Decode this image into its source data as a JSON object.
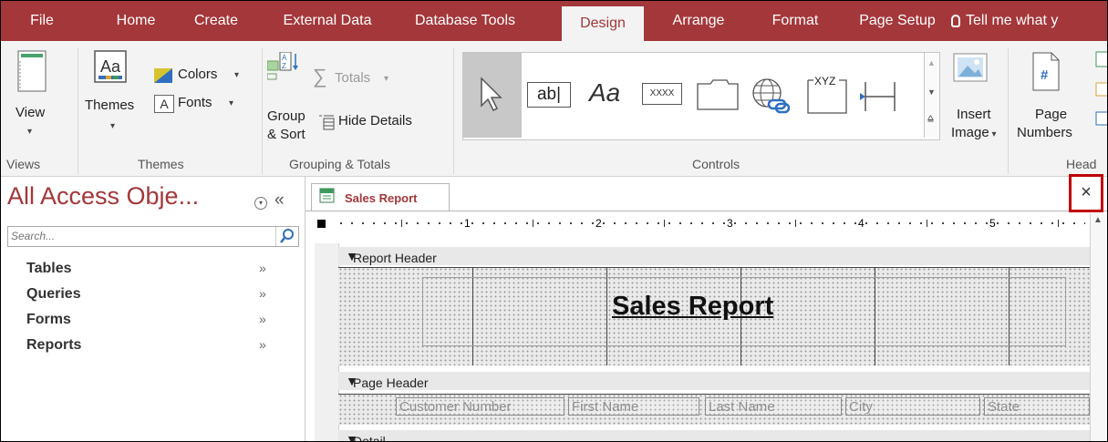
{
  "ribbon_tabs": [
    "File",
    "Home",
    "Create",
    "External Data",
    "Database Tools",
    "Design",
    "Arrange",
    "Format",
    "Page Setup"
  ],
  "active_tab": "Design",
  "tell_me": "Tell me what y",
  "groups": {
    "views": {
      "label": "Views",
      "view_button": "View"
    },
    "themes": {
      "label": "Themes",
      "themes_button": "Themes",
      "colors_button": "Colors",
      "fonts_button": "Fonts",
      "fonts_icon_text": "A",
      "themes_icon_text": "Aa"
    },
    "grouping": {
      "label": "Grouping & Totals",
      "group_sort_line1": "Group",
      "group_sort_line2": "& Sort",
      "totals": "Totals",
      "hide_details": "Hide Details"
    },
    "controls": {
      "label": "Controls",
      "textbox_text": "ab|",
      "label_text": "Aa",
      "button_text": "XXXX",
      "chart_text": "XYZ"
    },
    "insert_image": {
      "line1": "Insert",
      "line2": "Image"
    },
    "header_footer": {
      "page_numbers_line1": "Page",
      "page_numbers_line2": "Numbers",
      "page_numbers_icon": "#",
      "label_partial": "Head"
    }
  },
  "nav": {
    "title": "All Access Obje...",
    "collapse": "«",
    "search_placeholder": "Search...",
    "items": [
      "Tables",
      "Queries",
      "Forms",
      "Reports"
    ]
  },
  "document": {
    "tab_title": "Sales Report",
    "close_glyph": "×",
    "ruler_numbers": [
      "1",
      "2",
      "3",
      "4",
      "5"
    ],
    "sections": {
      "report_header": "Report Header",
      "page_header": "Page Header",
      "detail": "Detail"
    },
    "report_title": "Sales Report",
    "page_header_fields": [
      "Customer Number",
      "First Name",
      "Last Name",
      "City",
      "State"
    ]
  },
  "colors": {
    "accent": "#a4373a",
    "close_highlight": "#c00000"
  }
}
